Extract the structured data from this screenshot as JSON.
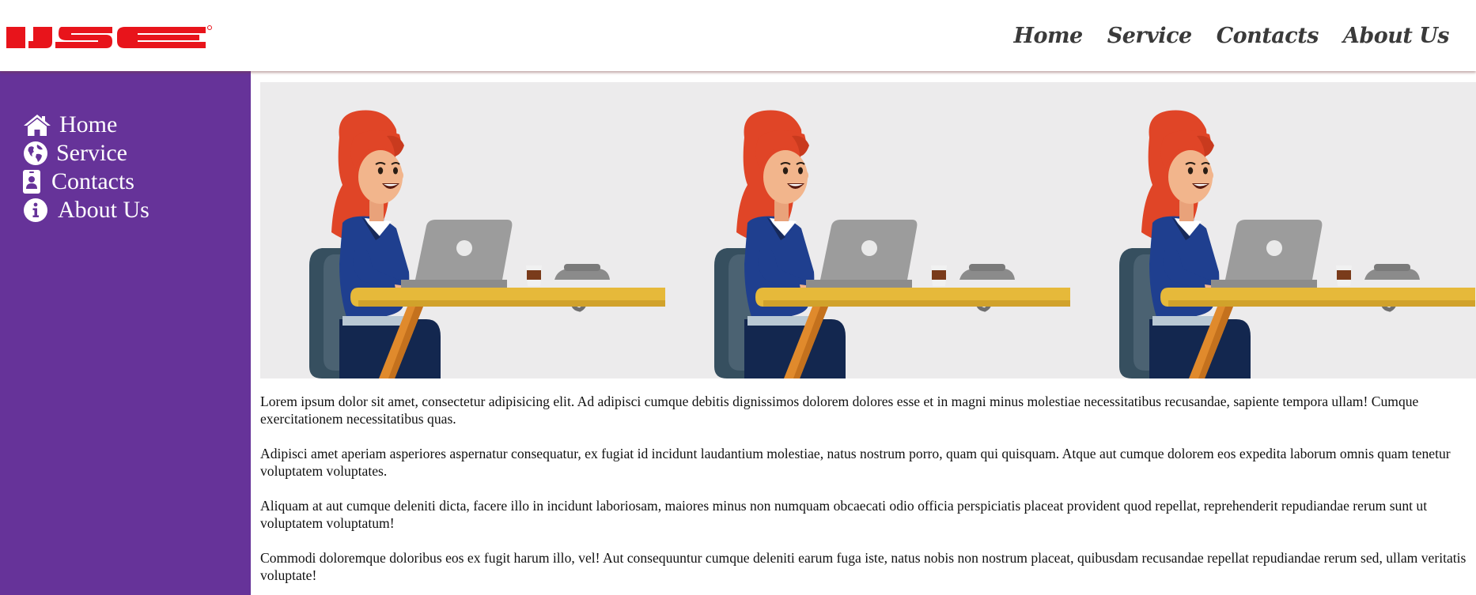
{
  "header": {
    "logo_text": "IJSE",
    "brand_color": "#e8141b",
    "nav": [
      "Home",
      "Service",
      "Contacts",
      "About Us"
    ]
  },
  "sidebar": {
    "background": "#663399",
    "items": [
      {
        "label": "Home",
        "icon": "home-icon"
      },
      {
        "label": "Service",
        "icon": "globe-icon"
      },
      {
        "label": "Contacts",
        "icon": "contact-card-icon"
      },
      {
        "label": "About Us",
        "icon": "info-icon"
      }
    ]
  },
  "main": {
    "banner_image": "woman-working-on-laptop-illustration",
    "paragraphs": [
      "Lorem ipsum dolor sit amet, consectetur adipisicing elit. Ad adipisci cumque debitis dignissimos dolorem dolores esse et in magni minus molestiae necessitatibus recusandae, sapiente tempora ullam! Cumque exercitationem necessitatibus quas.",
      "Adipisci amet aperiam asperiores aspernatur consequatur, ex fugiat id incidunt laudantium molestiae, natus nostrum porro, quam qui quisquam. Atque aut cumque dolorem eos expedita laborum omnis quam tenetur voluptatem voluptates.",
      "Aliquam at aut cumque deleniti dicta, facere illo in incidunt laboriosam, maiores minus non numquam obcaecati odio officia perspiciatis placeat provident quod repellat, reprehenderit repudiandae rerum sunt ut voluptatem voluptatum!",
      "Commodi doloremque doloribus eos ex fugit harum illo, vel! Aut consequuntur cumque deleniti earum fuga iste, natus nobis non nostrum placeat, quibusdam recusandae repellat repudiandae rerum sed, ullam veritatis voluptate!"
    ]
  }
}
